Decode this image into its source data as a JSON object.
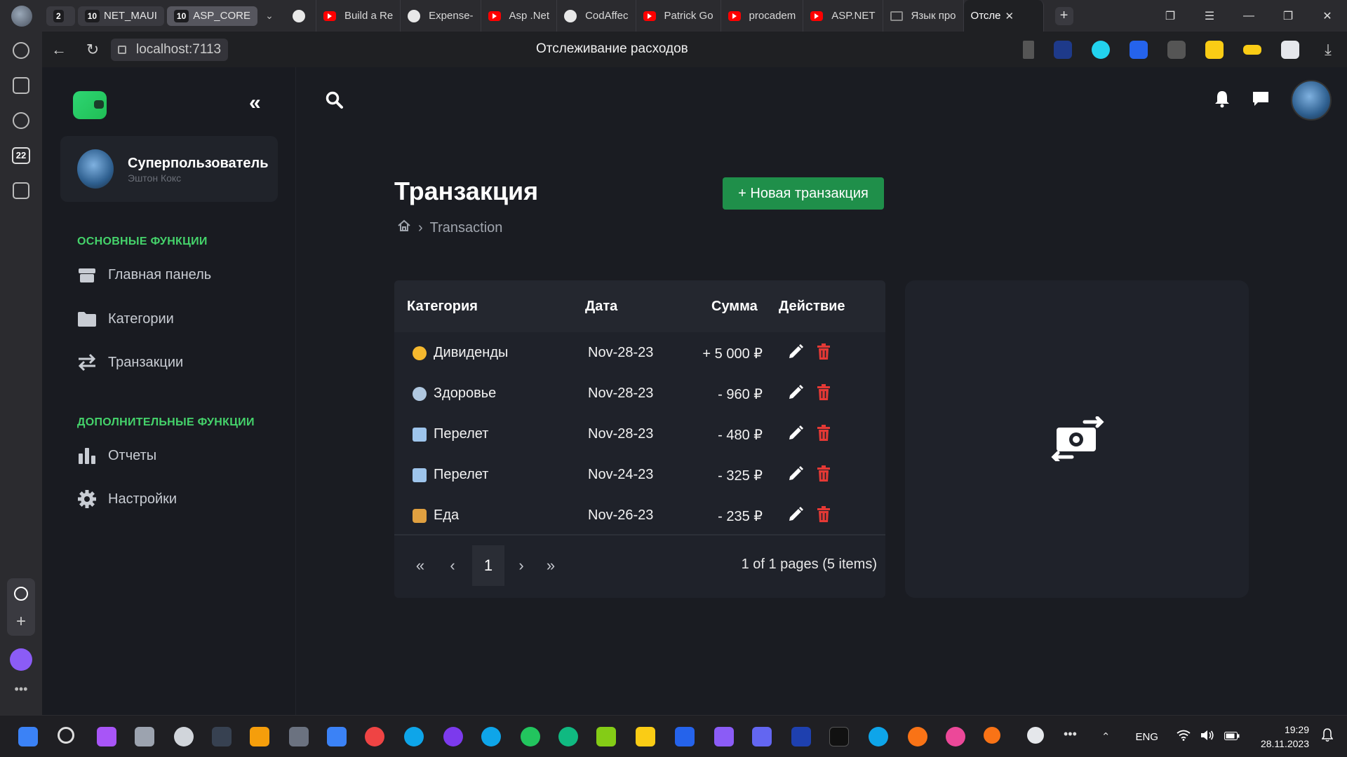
{
  "browser": {
    "tab_groups": [
      {
        "count": "2",
        "label": ""
      },
      {
        "count": "10",
        "label": "NET_MAUI"
      },
      {
        "count": "10",
        "label": "ASP_CORE"
      }
    ],
    "tabs": [
      {
        "label": "",
        "icon": "github-icon"
      },
      {
        "label": "Build a Re",
        "icon": "youtube-icon"
      },
      {
        "label": "Expense-",
        "icon": "github-icon"
      },
      {
        "label": "Asp .Net",
        "icon": "youtube-icon"
      },
      {
        "label": "CodAffec",
        "icon": "github-icon"
      },
      {
        "label": "Patrick Go",
        "icon": "youtube-icon"
      },
      {
        "label": "procadem",
        "icon": "youtube-icon"
      },
      {
        "label": "ASP.NET",
        "icon": "youtube-icon"
      },
      {
        "label": "Язык про",
        "icon": "mail-icon"
      },
      {
        "label": "Отсле",
        "icon": "app-icon",
        "active": true
      }
    ],
    "url": "localhost:7113",
    "page_title": "Отслеживание расходов",
    "sidebar_badge": "22"
  },
  "app": {
    "user": {
      "name": "Суперпользователь",
      "subtitle": "Эштон Кокс"
    },
    "sections": {
      "main": "ОСНОВНЫЕ ФУНКЦИИ",
      "extra": "ДОПОЛНИТЕЛЬНЫЕ ФУНКЦИИ"
    },
    "nav": {
      "dashboard": "Главная панель",
      "categories": "Категории",
      "transactions": "Транзакции",
      "reports": "Отчеты",
      "settings": "Настройки"
    },
    "page": {
      "title": "Транзакция",
      "new_button": "+ Новая транзакция",
      "breadcrumb": "Transaction"
    },
    "table": {
      "headers": {
        "category": "Категория",
        "date": "Дата",
        "amount": "Сумма",
        "action": "Действие"
      },
      "rows": [
        {
          "icon": "coin-icon",
          "category": "Дивиденды",
          "date": "Nov-28-23",
          "amount": "+ 5 000 ₽"
        },
        {
          "icon": "health-icon",
          "category": "Здоровье",
          "date": "Nov-28-23",
          "amount": "- 960 ₽"
        },
        {
          "icon": "airplane-icon",
          "category": "Перелет",
          "date": "Nov-28-23",
          "amount": "- 480 ₽"
        },
        {
          "icon": "airplane-icon",
          "category": "Перелет",
          "date": "Nov-24-23",
          "amount": "- 325 ₽"
        },
        {
          "icon": "food-icon",
          "category": "Еда",
          "date": "Nov-26-23",
          "amount": "- 235 ₽"
        }
      ],
      "pager": {
        "first": "«",
        "prev": "‹",
        "current": "1",
        "next": "›",
        "last": "»",
        "info": "1 of 1 pages (5 items)"
      }
    }
  },
  "taskbar": {
    "lang": "ENG",
    "time": "19:29",
    "date": "28.11.2023"
  },
  "colors": {
    "accent": "#1f8f4a",
    "section": "#45d36b",
    "delete": "#e53935"
  }
}
